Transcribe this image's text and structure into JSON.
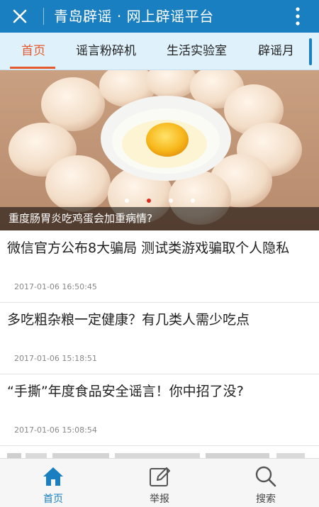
{
  "appbar": {
    "title": "青岛辟谣 · 网上辟谣平台",
    "close_icon": "close-icon",
    "more_icon": "more-vertical-icon",
    "color": "#1a7fc0"
  },
  "tabs": [
    {
      "label": "首页",
      "active": true
    },
    {
      "label": "谣言粉碎机",
      "active": false
    },
    {
      "label": "生活实验室",
      "active": false
    },
    {
      "label": "辟谣月",
      "active": false
    }
  ],
  "banner": {
    "caption": "重度肠胃炎吃鸡蛋会加重病情?",
    "slide_count": 4,
    "active_slide": 2
  },
  "articles": [
    {
      "title": "微信官方公布8大骗局 测试类游戏骗取个人隐私",
      "time": "2017-01-06 16:50:45"
    },
    {
      "title": "多吃粗杂粮一定健康？有几类人需少吃点",
      "time": "2017-01-06 15:18:51"
    },
    {
      "title": "“手撕”年度食品安全谣言！你中招了没?",
      "time": "2017-01-06 15:08:54"
    }
  ],
  "bottom_nav": [
    {
      "label": "首页",
      "icon": "home-icon",
      "active": true
    },
    {
      "label": "举报",
      "icon": "edit-icon",
      "active": false
    },
    {
      "label": "搜索",
      "icon": "search-icon",
      "active": false
    }
  ],
  "accent_color": "#e5592c"
}
